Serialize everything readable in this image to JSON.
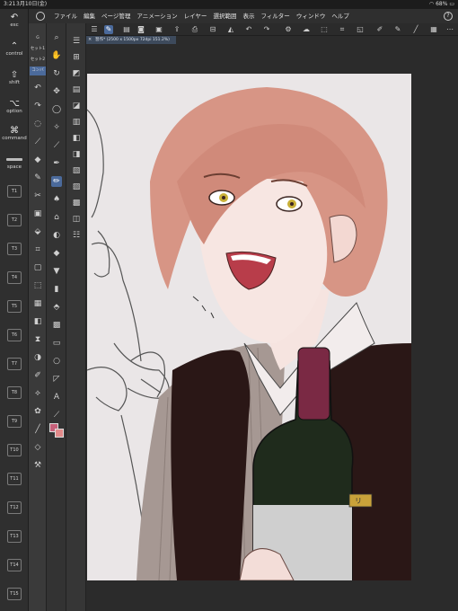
{
  "status": {
    "time": "3:21",
    "date": "3月10日(金)",
    "battery": "68%"
  },
  "menu": {
    "items": [
      "ファイル",
      "編集",
      "ページ管理",
      "アニメーション",
      "レイヤー",
      "選択範囲",
      "表示",
      "フィルター",
      "ウィンドウ",
      "ヘルプ"
    ]
  },
  "modifiers": {
    "esc": "esc",
    "control": "control",
    "shift": "shift",
    "option": "option",
    "command": "command",
    "space": "space",
    "quick_keys": [
      "T1",
      "T2",
      "T3",
      "T4",
      "T5",
      "T6",
      "T7",
      "T8",
      "T9",
      "T10",
      "T11",
      "T12",
      "T13",
      "T14",
      "T15"
    ]
  },
  "subtool_tabs": [
    "G",
    "セット1",
    "セット2",
    "コンバ"
  ],
  "document_tab": {
    "label": "習作* (2500 x 1500px 72dpi 151.2%)"
  },
  "colors": {
    "main": "#c7607a",
    "sub": "#e28a8a",
    "accent": "#4b6a9b",
    "canvas": "#eae6e7"
  },
  "illustration": {
    "bottle_label_mark": "リ"
  }
}
